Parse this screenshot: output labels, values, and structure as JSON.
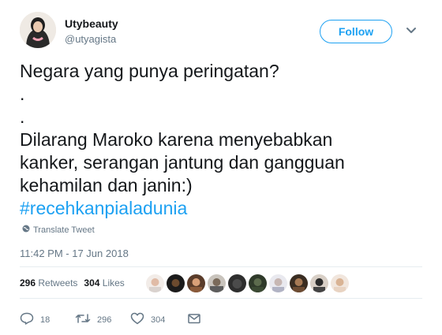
{
  "user": {
    "display_name": "Utybeauty",
    "handle": "@utyagista"
  },
  "follow_label": "Follow",
  "tweet": {
    "text": "Negara yang punya peringatan?\n.\n.\nDilarang Maroko karena menyebabkan\nkanker, serangan jantung dan gangguan\nkehamilan dan janin:)",
    "hashtag": "#recehkanpialadunia",
    "translate_label": "Translate Tweet",
    "timestamp": "11:42 PM - 17 Jun 2018"
  },
  "stats": {
    "retweets_count": "296",
    "retweets_label": "Retweets",
    "likes_count": "304",
    "likes_label": "Likes"
  },
  "actions": {
    "replies": "18",
    "retweets": "296",
    "likes": "304"
  },
  "colors": {
    "accent": "#1da1f2",
    "muted": "#657786",
    "text": "#14171a"
  }
}
